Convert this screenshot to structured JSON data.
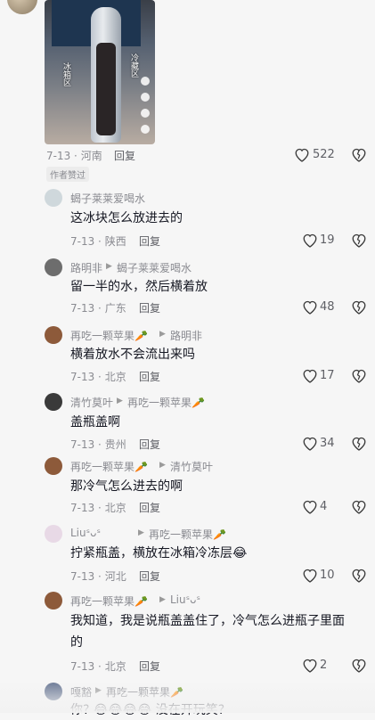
{
  "top": {
    "thumb_label_left": "冰箱区",
    "thumb_label_right": "冷藏区",
    "date": "7-13",
    "location": "河南",
    "reply": "回复",
    "likes": "522",
    "author_badge": "作者赞过"
  },
  "comments": [
    {
      "name": "蝎子莱莱爱喝水",
      "reply_to": "",
      "text": "这冰块怎么放进去的",
      "date": "7-13",
      "location": "陕西",
      "reply": "回复",
      "likes": "19",
      "avatar_color": "#cfd8dc"
    },
    {
      "name": "路明非",
      "reply_to": "蝎子莱莱爱喝水",
      "text": "留一半的水，然后横着放",
      "date": "7-13",
      "location": "广东",
      "reply": "回复",
      "likes": "48",
      "avatar_color": "#6d6d6d"
    },
    {
      "name": "再吃一颗苹果🥕",
      "reply_to": "路明非",
      "text": "横着放水不会流出来吗",
      "date": "7-13",
      "location": "北京",
      "reply": "回复",
      "likes": "17",
      "avatar_color": "#8d5a3a"
    },
    {
      "name": "清竹莫叶",
      "reply_to": "再吃一颗苹果🥕",
      "text": "盖瓶盖啊",
      "date": "7-13",
      "location": "贵州",
      "reply": "回复",
      "likes": "34",
      "avatar_color": "#3a3a3a"
    },
    {
      "name": "再吃一颗苹果🥕",
      "reply_to": "清竹莫叶",
      "text": "那冷气怎么进去的啊",
      "date": "7-13",
      "location": "北京",
      "reply": "回复",
      "likes": "4",
      "avatar_color": "#8d5a3a"
    },
    {
      "name": "Liuˢᴗˢ",
      "reply_to": "再吃一颗苹果🥕",
      "text": "拧紧瓶盖，横放在冰箱冷冻层😂",
      "date": "7-13",
      "location": "河北",
      "reply": "回复",
      "likes": "10",
      "avatar_color": "#e8d9e6"
    },
    {
      "name": "再吃一颗苹果🥕",
      "reply_to": "Liuˢᴗˢ",
      "text_line1": "我知道，我是说瓶盖盖住了，冷气怎么进瓶子里面",
      "text_line2": "的",
      "date": "7-13",
      "location": "北京",
      "reply": "回复",
      "likes": "2",
      "avatar_color": "#8d5a3a"
    },
    {
      "name": "嘎豁",
      "reply_to": "再吃一颗苹果🥕",
      "text": "你? 😂😂😂😂 没在开玩笑?",
      "avatar_color": "#5a6a8a"
    }
  ]
}
